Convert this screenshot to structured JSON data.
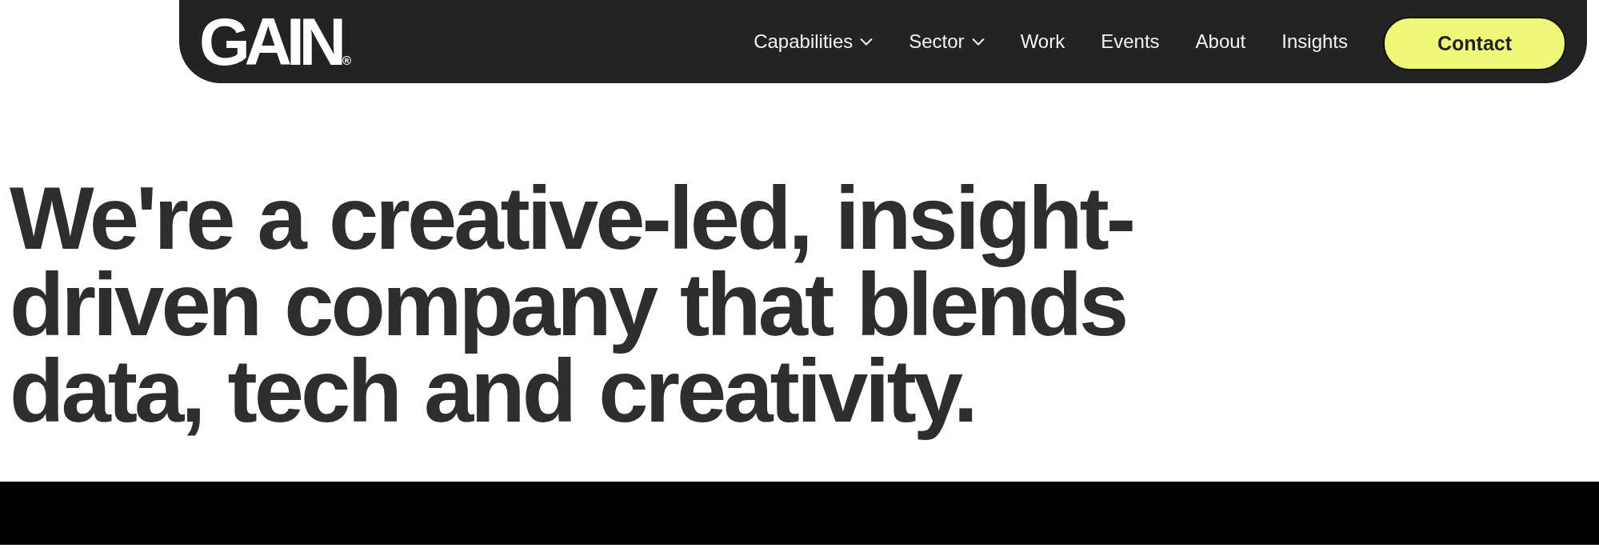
{
  "header": {
    "logo": "GAIN",
    "logo_mark": "®",
    "nav": [
      {
        "label": "Capabilities",
        "dropdown": true
      },
      {
        "label": "Sector",
        "dropdown": true
      },
      {
        "label": "Work",
        "dropdown": false
      },
      {
        "label": "Events",
        "dropdown": false
      },
      {
        "label": "About",
        "dropdown": false
      },
      {
        "label": "Insights",
        "dropdown": false
      }
    ],
    "cta": "Contact"
  },
  "hero": {
    "headline": "We're a creative-led, insight-driven company that blends data, tech and creativity."
  }
}
